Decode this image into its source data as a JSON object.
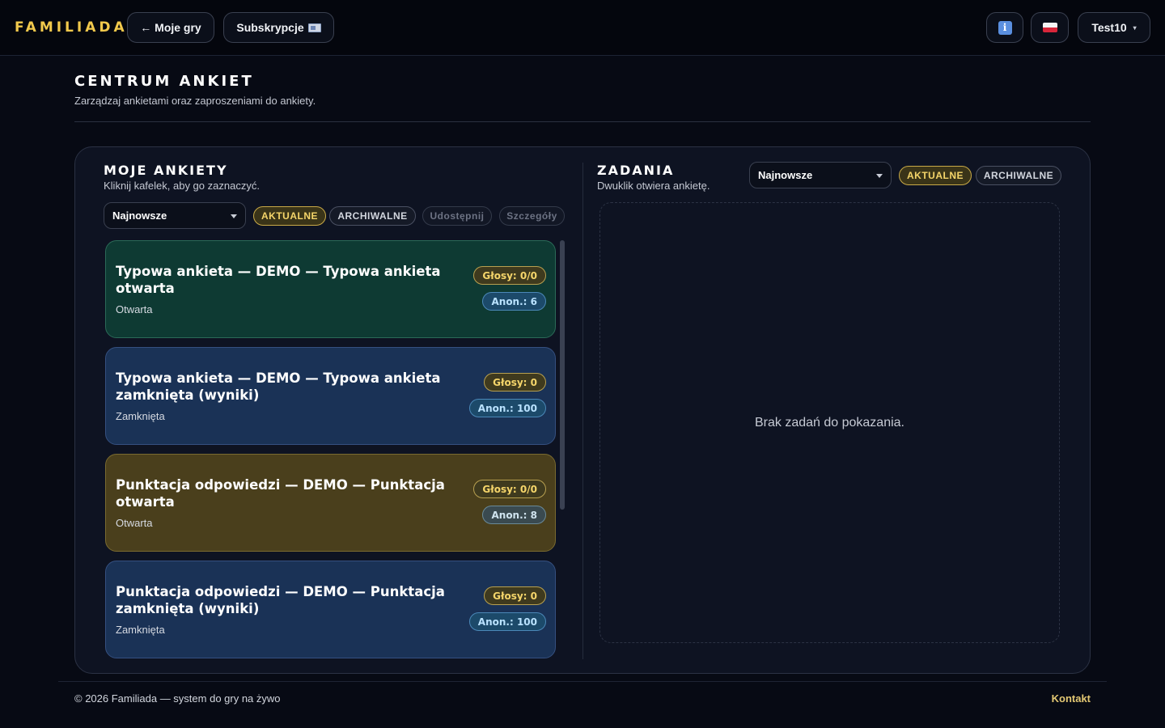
{
  "topbar": {
    "logo": "FAMILIADA",
    "back_label": "← Moje gry",
    "subscriptions_label": "Subskrypcje",
    "info_icon_text": "i",
    "user_label": "Test10",
    "user_caret": "▾"
  },
  "header": {
    "title": "CENTRUM ANKIET",
    "subtitle": "Zarządzaj ankietami oraz zaproszeniami do ankiety."
  },
  "my_polls": {
    "title": "MOJE ANKIETY",
    "subtitle": "Kliknij kafelek, aby go zaznaczyć.",
    "sort_value": "Najnowsze",
    "filters": {
      "current": "AKTUALNE",
      "archived": "ARCHIWALNE"
    },
    "actions": {
      "share": "Udostępnij",
      "details": "Szczegóły"
    },
    "cards": [
      {
        "title": "Typowa ankieta — DEMO — Typowa ankieta otwarta",
        "status": "Otwarta",
        "votes": "Głosy: 0/0",
        "anon": "Anon.: 6",
        "color": "#0e3a33"
      },
      {
        "title": "Typowa ankieta — DEMO — Typowa ankieta zamknięta (wyniki)",
        "status": "Zamknięta",
        "votes": "Głosy: 0",
        "anon": "Anon.: 100",
        "color": "#1a3256"
      },
      {
        "title": "Punktacja odpowiedzi — DEMO — Punktacja otwarta",
        "status": "Otwarta",
        "votes": "Głosy: 0/0",
        "anon": "Anon.: 8",
        "color": "#4a3f1c"
      },
      {
        "title": "Punktacja odpowiedzi — DEMO — Punktacja zamknięta (wyniki)",
        "status": "Zamknięta",
        "votes": "Głosy: 0",
        "anon": "Anon.: 100",
        "color": "#1a3256"
      }
    ]
  },
  "tasks": {
    "title": "ZADANIA",
    "subtitle": "Dwuklik otwiera ankietę.",
    "sort_value": "Najnowsze",
    "filters": {
      "current": "AKTUALNE",
      "archived": "ARCHIWALNE"
    },
    "empty_text": "Brak zadań do pokazania."
  },
  "footer": {
    "copyright": "© 2026 Familiada — system do gry na żywo",
    "contact": "Kontakt"
  },
  "colors": {
    "accent": "#f2c94c",
    "background": "#070a14",
    "panel": "#0e1322"
  }
}
